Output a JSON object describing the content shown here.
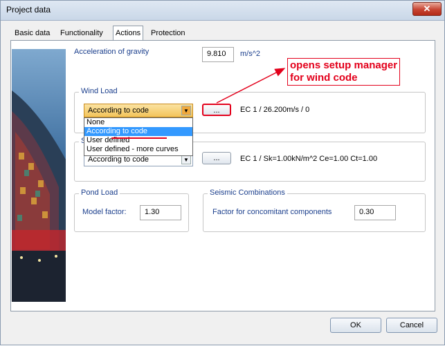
{
  "window": {
    "title": "Project data",
    "close_label": "✕"
  },
  "tabs": [
    {
      "label": "Basic data",
      "active": false
    },
    {
      "label": "Functionality",
      "active": false
    },
    {
      "label": "Actions",
      "active": true
    },
    {
      "label": "Protection",
      "active": false
    }
  ],
  "gravity": {
    "label": "Acceleration of gravity",
    "value": "9.810",
    "unit": "m/s^2"
  },
  "wind_load": {
    "group_label": "Wind Load",
    "selected": "According to code",
    "info": "EC 1 / 26.200m/s / 0",
    "setup_button_label": "...",
    "options": [
      "None",
      "According to code",
      "User defined",
      "User defined - more curves"
    ],
    "highlighted_option": "According to code"
  },
  "snow_load": {
    "group_label_visible": "S",
    "selected": "According to code",
    "info": "EC 1 / Sk=1.00kN/m^2 Ce=1.00 Ct=1.00",
    "setup_button_label": "..."
  },
  "pond_load": {
    "group_label": "Pond Load",
    "model_factor_label": "Model factor:",
    "model_factor_value": "1.30"
  },
  "seismic": {
    "group_label": "Seismic Combinations",
    "factor_label": "Factor for concomitant components",
    "factor_value": "0.30"
  },
  "annotation": {
    "text_line1": "opens setup manager",
    "text_line2": "for wind code",
    "color": "#e3001b"
  },
  "buttons": {
    "ok_label": "OK",
    "cancel_label": "Cancel"
  },
  "colors": {
    "accent_blue": "#1a3e8c",
    "selection": "#3399ff",
    "highlight_red": "#e3001b"
  }
}
